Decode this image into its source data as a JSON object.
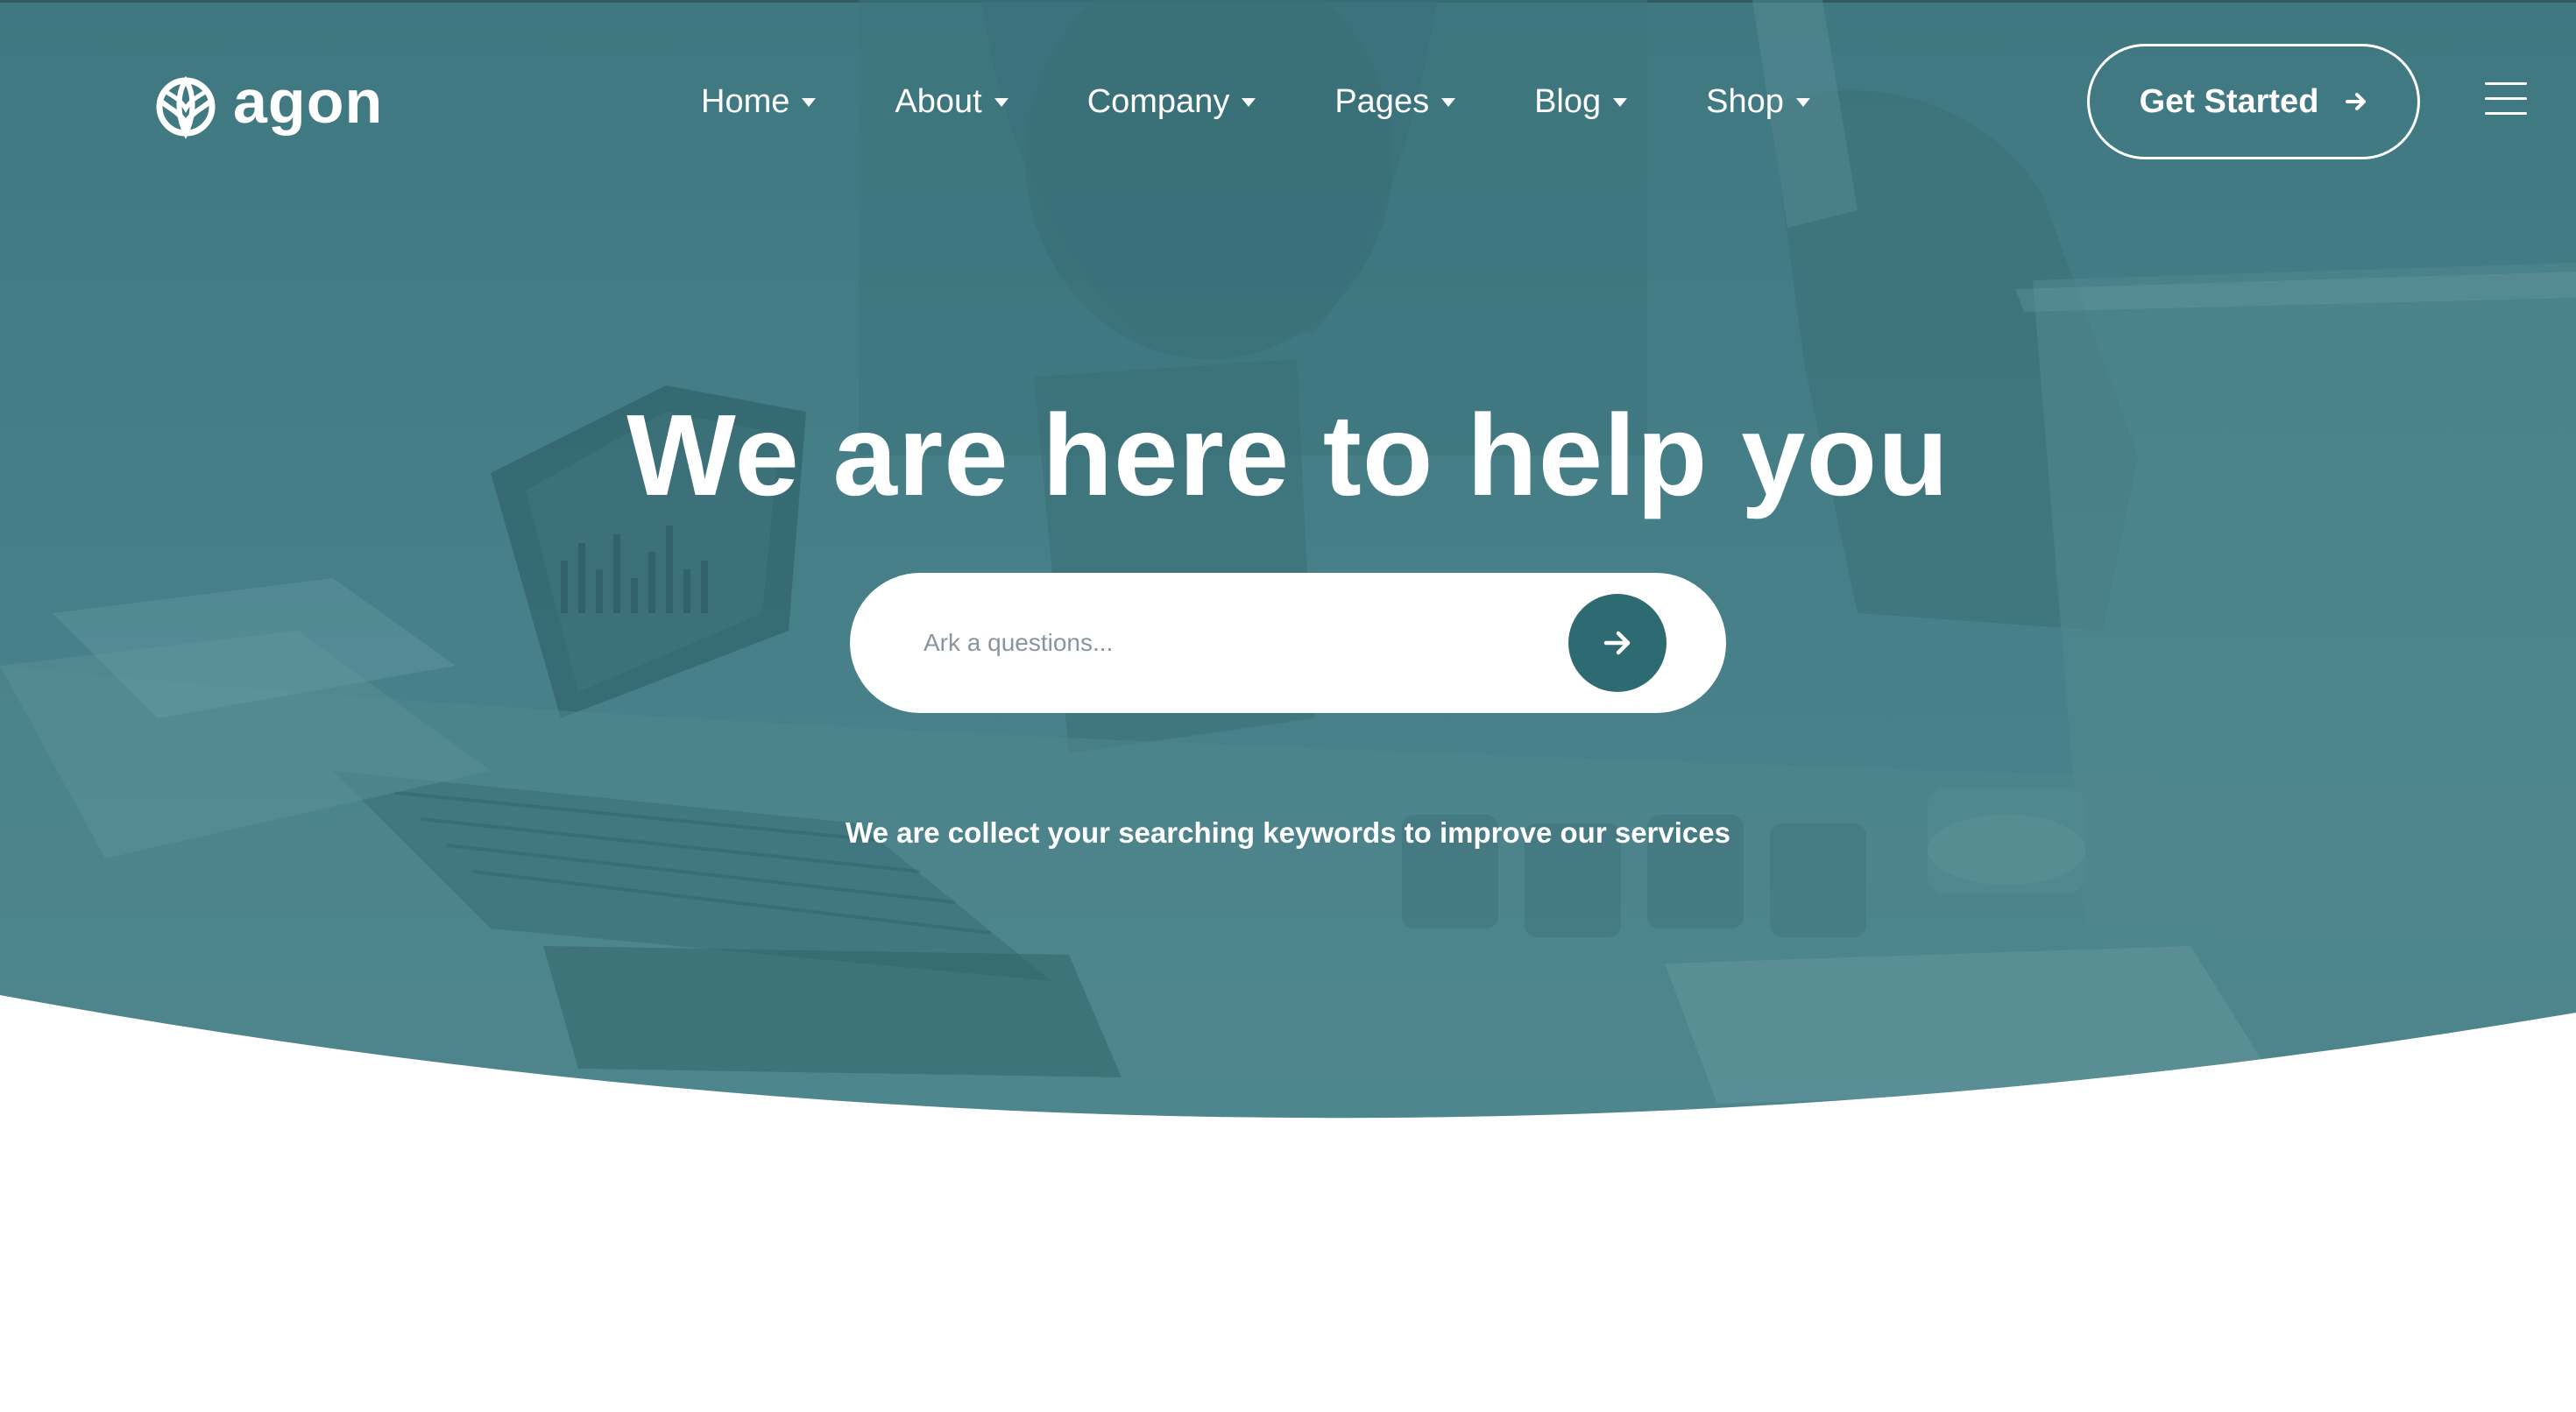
{
  "brand": {
    "name": "agon",
    "logo_icon": "leaf-globe-icon"
  },
  "nav": {
    "items": [
      {
        "label": "Home",
        "has_dropdown": true
      },
      {
        "label": "About",
        "has_dropdown": true
      },
      {
        "label": "Company",
        "has_dropdown": true
      },
      {
        "label": "Pages",
        "has_dropdown": true
      },
      {
        "label": "Blog",
        "has_dropdown": true
      },
      {
        "label": "Shop",
        "has_dropdown": true
      }
    ],
    "menu_icon": "hamburger-menu-icon"
  },
  "cta": {
    "label": "Get Started",
    "icon": "arrow-right-icon"
  },
  "hero": {
    "title": "We are here to help you",
    "search": {
      "placeholder": "Ark a questions...",
      "value": "",
      "submit_icon": "arrow-right-icon"
    },
    "note": "We are collect your searching keywords to improve our services"
  },
  "colors": {
    "hero_overlay": "#467f88",
    "accent": "#2e6a72",
    "text_on_hero": "#ffffff",
    "page_background": "#ffffff"
  }
}
